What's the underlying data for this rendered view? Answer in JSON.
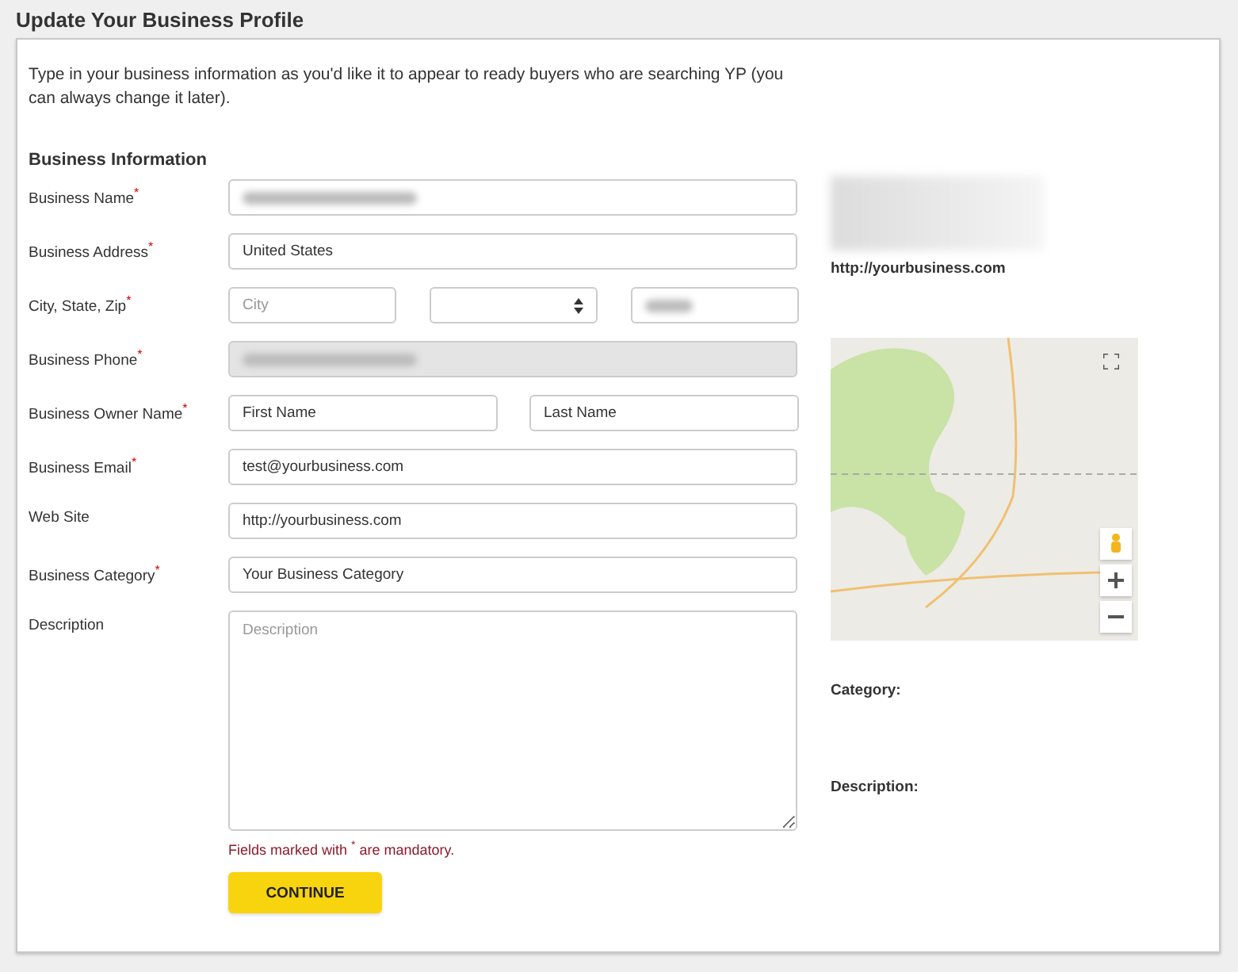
{
  "page_title": "Update Your Business Profile",
  "intro": "Type in your business information as you'd like it to appear to ready buyers who are searching YP (you can always change it later).",
  "section_title": "Business Information",
  "fields": [
    {
      "label": "Business Name",
      "required_mark": "*",
      "kind": "text",
      "inputs": [
        {
          "kind": "input",
          "redacted": true,
          "disabled": false
        }
      ]
    },
    {
      "label": "Business Address",
      "required_mark": "*",
      "kind": "text",
      "inputs": [
        {
          "kind": "input",
          "value": "United States",
          "disabled": false
        }
      ]
    },
    {
      "label": "City, State, Zip",
      "required_mark": "*",
      "kind": "row",
      "inputs": [
        {
          "kind": "input",
          "placeholder": "City",
          "disabled": false
        },
        {
          "kind": "select",
          "disabled": false
        },
        {
          "kind": "input",
          "redacted": true,
          "disabled": false
        }
      ]
    },
    {
      "label": "Business Phone",
      "required_mark": "*",
      "kind": "text",
      "inputs": [
        {
          "kind": "input",
          "redacted": true,
          "disabled": true
        }
      ]
    },
    {
      "label": "Business Owner Name",
      "required_mark": "*",
      "kind": "row",
      "inputs": [
        {
          "kind": "input",
          "value": "First Name",
          "disabled": false
        },
        {
          "kind": "input",
          "value": "Last Name",
          "disabled": false
        }
      ]
    },
    {
      "label": "Business Email",
      "required_mark": "*",
      "kind": "text",
      "inputs": [
        {
          "kind": "input",
          "value": "test@yourbusiness.com",
          "disabled": false
        }
      ]
    },
    {
      "label": "Web Site",
      "kind": "text",
      "inputs": [
        {
          "kind": "input",
          "value": "http://yourbusiness.com",
          "disabled": false
        }
      ]
    },
    {
      "label": "Business Category",
      "required_mark": "*",
      "kind": "text",
      "inputs": [
        {
          "kind": "input",
          "value": "Your Business Category",
          "disabled": false
        }
      ]
    },
    {
      "label": "Description",
      "kind": "textarea",
      "inputs": [
        {
          "kind": "textarea",
          "placeholder": "Description",
          "disabled": false
        }
      ]
    }
  ],
  "mandatory_note": "Fields marked with $^{*}$ are mandatory.",
  "continue_button": "CONTINUE",
  "preview": {
    "website": "http://yourbusiness.com",
    "category_label": "Category:",
    "description_label": "Description:"
  }
}
